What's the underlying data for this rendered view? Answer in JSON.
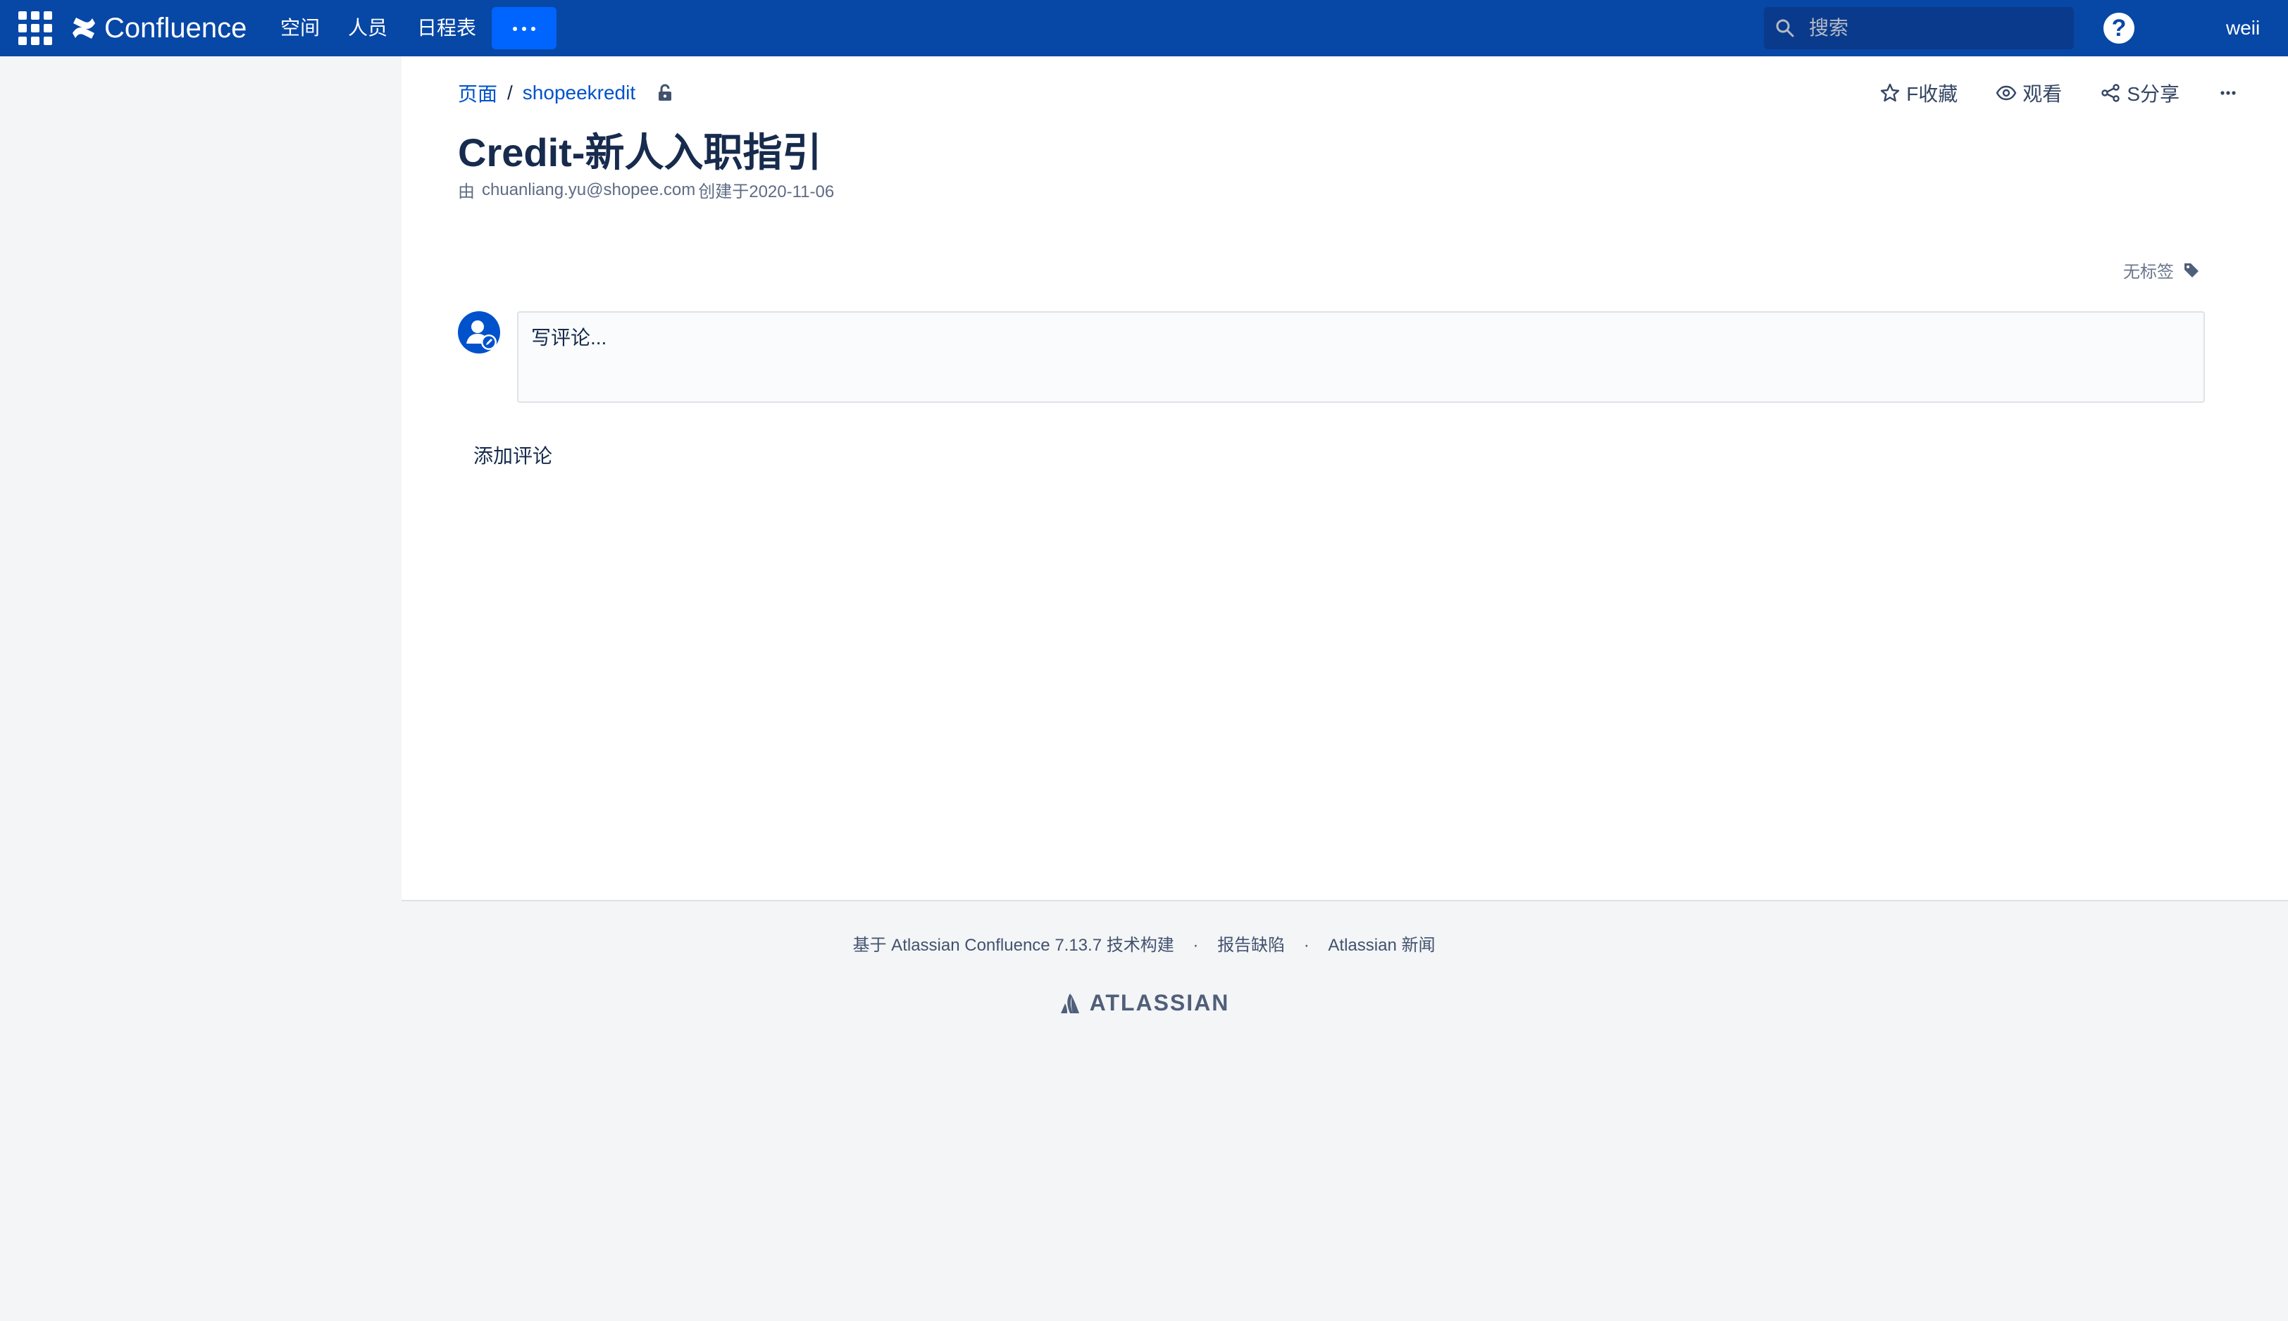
{
  "header": {
    "product": "Confluence",
    "nav": [
      "空间",
      "人员",
      "日程表"
    ],
    "search_placeholder": "搜索",
    "help": "?",
    "user": "weii"
  },
  "breadcrumb": {
    "root": "页面",
    "separator": "/",
    "space": "shopeekredit"
  },
  "actions": {
    "favorite": "F收藏",
    "watch": "观看",
    "share": "S分享"
  },
  "page": {
    "title": "Credit-新人入职指引",
    "byline_prefix": "由",
    "author": "chuanliang.yu@shopee.com",
    "created_text": "创建于2020-11-06"
  },
  "labels": {
    "none": "无标签"
  },
  "comments": {
    "placeholder": "写评论...",
    "add": "添加评论"
  },
  "footer": {
    "powered": "基于 Atlassian Confluence 7.13.7 技术构建",
    "bug": "报告缺陷",
    "news": "Atlassian 新闻",
    "brand": "ATLASSIAN"
  },
  "colors": {
    "topbar": "#0747a6",
    "accent": "#0065ff",
    "link": "#0052cc"
  }
}
